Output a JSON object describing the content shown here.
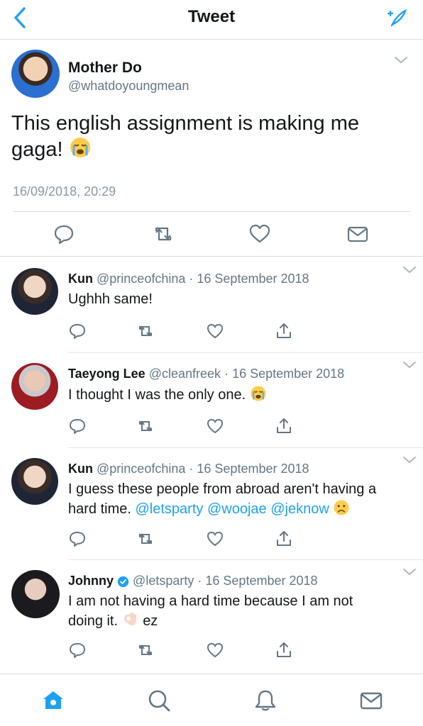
{
  "header": {
    "title": "Tweet"
  },
  "main_tweet": {
    "name": "Mother Do",
    "handle": "@whatdoyoungmean",
    "text_line1": "This english assignment is making me",
    "text_line2": "gaga!",
    "timestamp": "16/09/2018, 20:29"
  },
  "replies": [
    {
      "name": "Kun",
      "handle": "@princeofchina",
      "sep": "·",
      "date": "16 September 2018",
      "line1": "Ughhh same!"
    },
    {
      "name": "Taeyong Lee",
      "handle": "@cleanfreek",
      "sep": "·",
      "date": "16 September 2018",
      "line1": "I thought I was the only one."
    },
    {
      "name": "Kun",
      "handle": "@princeofchina",
      "sep": "·",
      "date": "16 September 2018",
      "line1": "I guess these people from abroad aren't having a",
      "line2_prefix": "hard time.",
      "mentions": [
        "@letsparty",
        "@woojae",
        "@jeknow"
      ]
    },
    {
      "name": "Johnny",
      "handle": "@letsparty",
      "sep": "·",
      "date": "16 September 2018",
      "line1": "I am not having a hard time because I am not",
      "line2_prefix": "doing it.",
      "line2_suffix": "ez"
    }
  ],
  "colors": {
    "accent": "#1da1f2",
    "secondary_text": "#657786",
    "divider": "#e1e8ed"
  }
}
